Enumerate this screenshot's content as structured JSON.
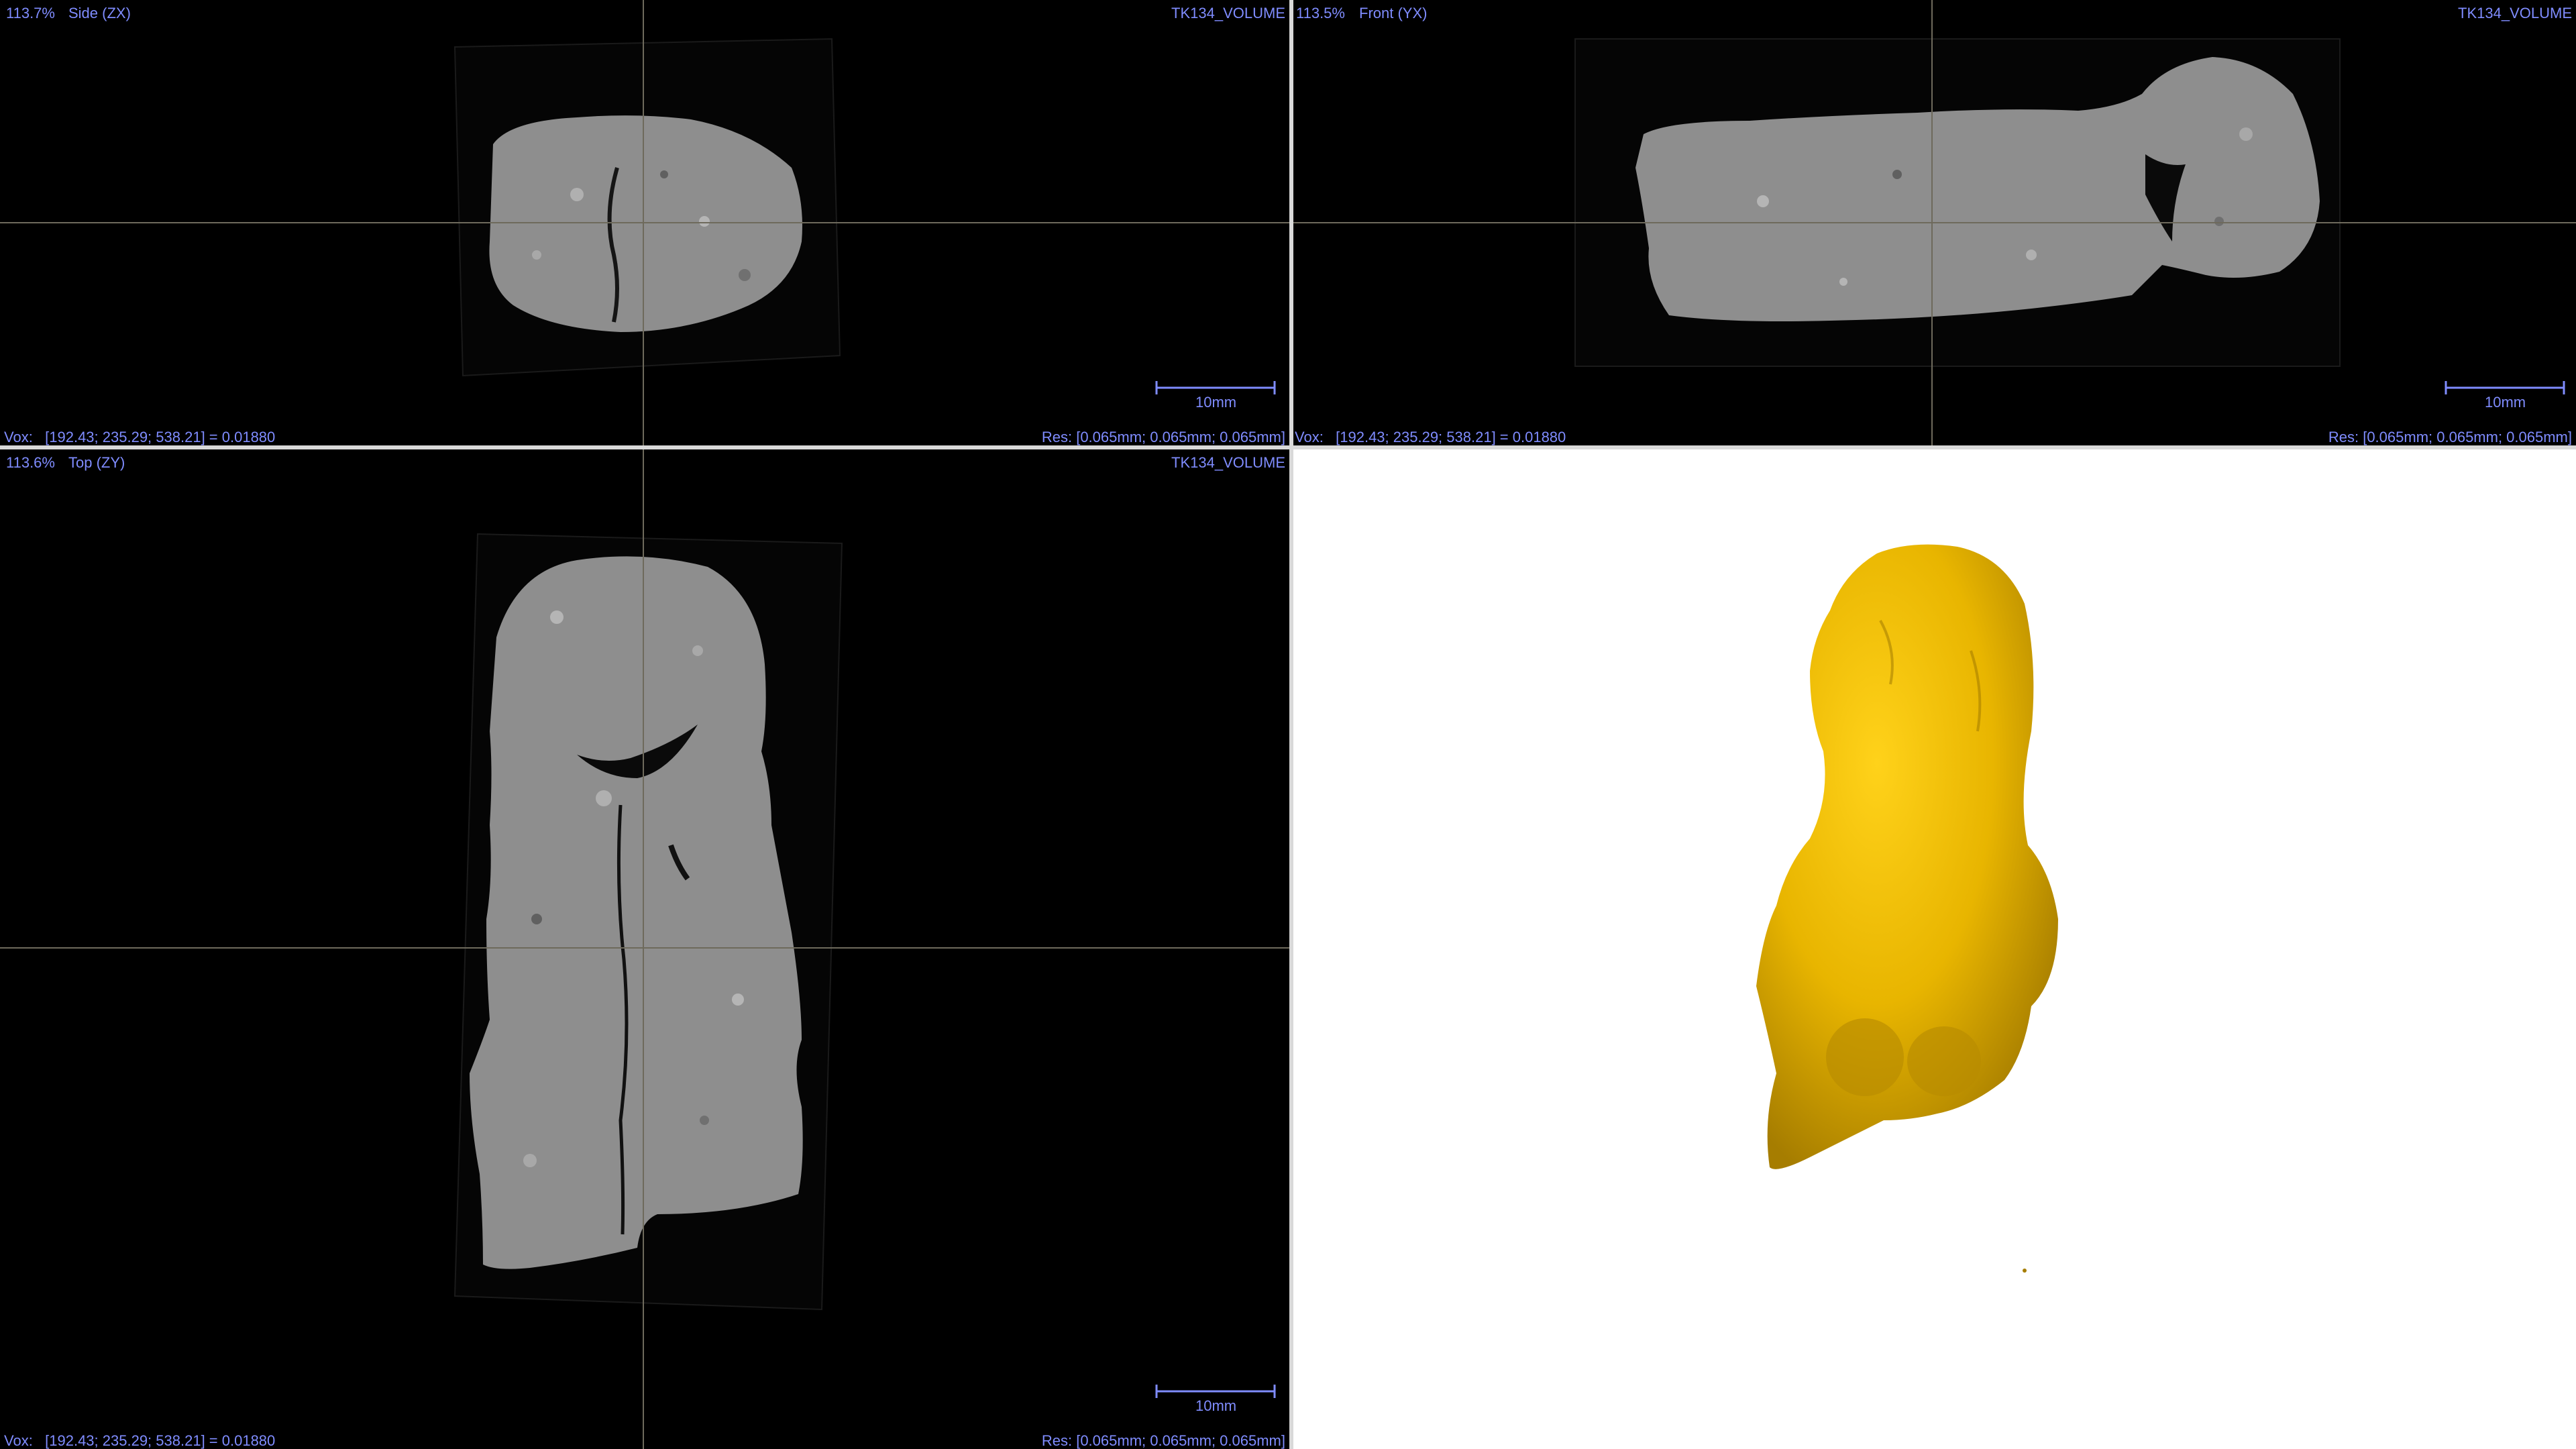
{
  "viewports": {
    "side": {
      "zoom": "113.7%",
      "view": "Side (ZX)",
      "volume": "TK134_VOLUME",
      "vox": "Vox:   [192.43; 235.29; 538.21] = 0.01880",
      "res": "Res: [0.065mm; 0.065mm; 0.065mm]",
      "scale": "10mm"
    },
    "front": {
      "zoom": "113.5%",
      "view": "Front (YX)",
      "volume": "TK134_VOLUME",
      "vox": "Vox:   [192.43; 235.29; 538.21] = 0.01880",
      "res": "Res: [0.065mm; 0.065mm; 0.065mm]",
      "scale": "10mm"
    },
    "top": {
      "zoom": "113.6%",
      "view": "Top (ZY)",
      "volume": "TK134_VOLUME",
      "vox": "Vox:   [192.43; 235.29; 538.21] = 0.01880",
      "res": "Res: [0.065mm; 0.065mm; 0.065mm]",
      "scale": "10mm"
    },
    "render3d": {}
  },
  "colors": {
    "overlay_text": "#7f8cff",
    "slice_gray": "#8e8e8e",
    "surface_yellow": "#e8b500",
    "crosshair": "#6e6a5c"
  }
}
